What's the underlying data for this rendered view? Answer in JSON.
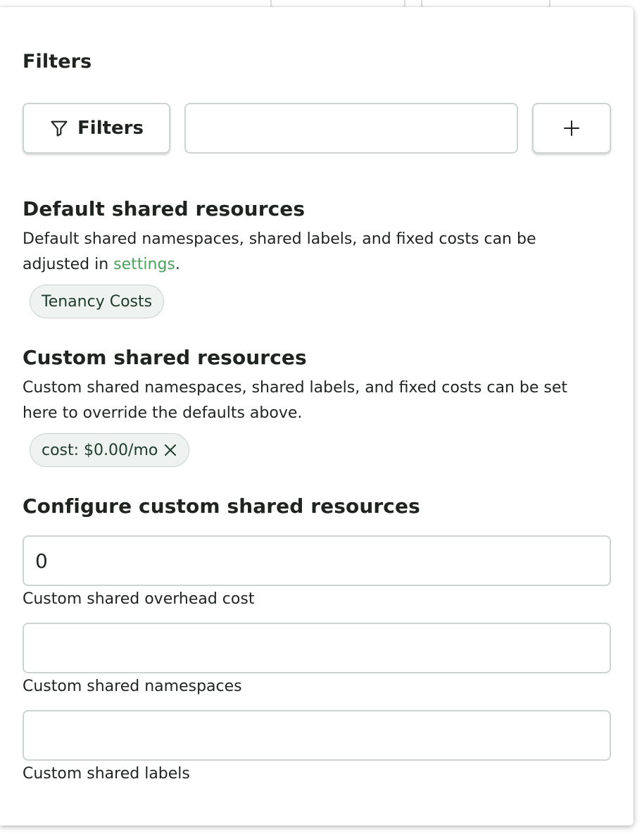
{
  "filters": {
    "title": "Filters",
    "button_label": "Filters",
    "input_value": "",
    "add_label": "+"
  },
  "default_shared": {
    "title": "Default shared resources",
    "desc_before": "Default shared namespaces, shared labels, and fixed costs can be adjusted in ",
    "link_text": "settings",
    "desc_after": ".",
    "chip_label": "Tenancy Costs"
  },
  "custom_shared": {
    "title": "Custom shared resources",
    "description": "Custom shared namespaces, shared labels, and fixed costs can be set here to override the defaults above.",
    "chip_label": "cost: $0.00/mo"
  },
  "configure": {
    "title": "Configure custom shared resources",
    "overhead_value": "0",
    "overhead_label": "Custom shared overhead cost",
    "namespaces_value": "",
    "namespaces_label": "Custom shared namespaces",
    "labels_value": "",
    "labels_label": "Custom shared labels"
  },
  "icons": {
    "filter": "funnel-icon",
    "chip_remove": "close-icon"
  },
  "colors": {
    "link": "#4aa35c",
    "chip_background": "#eef2f0",
    "chip_text": "#1e3b2c",
    "border": "#ccd5d1"
  }
}
